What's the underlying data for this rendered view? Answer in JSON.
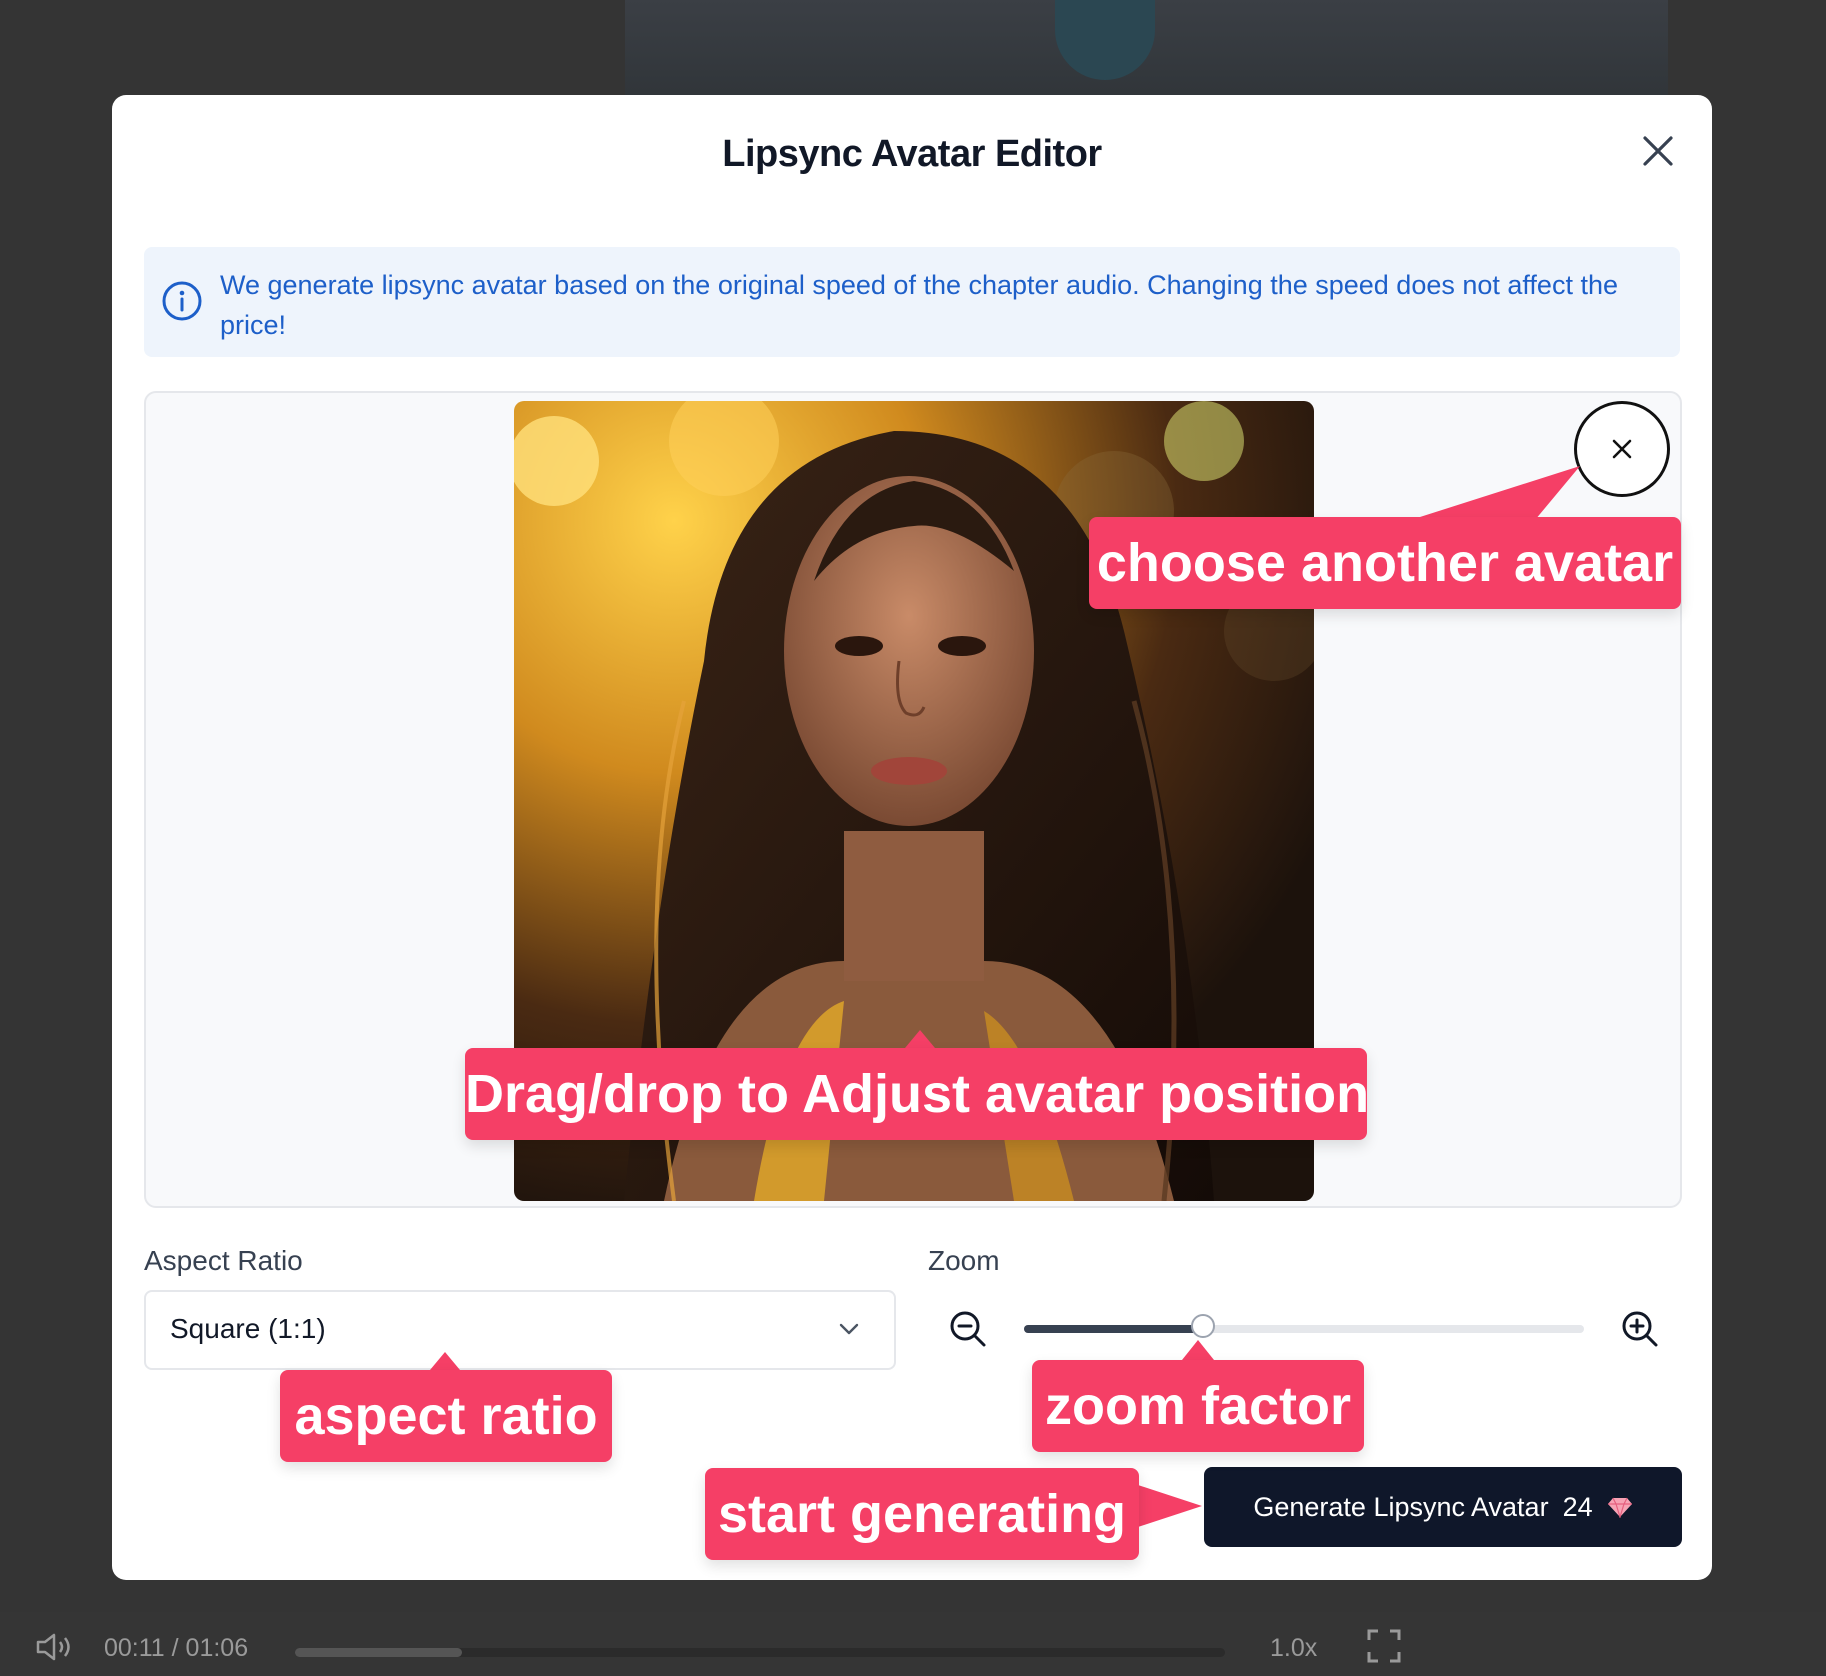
{
  "modal": {
    "title": "Lipsync Avatar Editor",
    "info_text": "We generate lipsync avatar based on the original speed of the chapter audio. Changing the speed does not affect the price!"
  },
  "controls": {
    "aspect_ratio_label": "Aspect Ratio",
    "aspect_ratio_value": "Square (1:1)",
    "zoom_label": "Zoom",
    "zoom_level": 0.32,
    "generate_label": "Generate Lipsync Avatar",
    "generate_cost": "24"
  },
  "annotations": {
    "choose_avatar": "choose another avatar",
    "drag_drop": "Drag/drop to Adjust avatar position",
    "aspect_ratio": "aspect ratio",
    "zoom_factor": "zoom factor",
    "start_generating": "start generating"
  },
  "player": {
    "time": "00:11 / 01:06",
    "progress": 0.18,
    "speed": "1.0x"
  },
  "colors": {
    "annotation": "#f53f66",
    "info_text": "#1d5fc9",
    "button_bg": "#0f172a"
  }
}
